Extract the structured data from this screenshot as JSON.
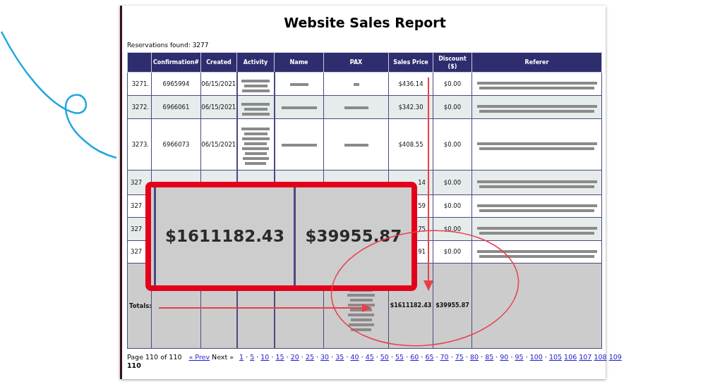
{
  "title": "Website Sales Report",
  "reservations_found": "Reservations found: 3277",
  "columns": [
    "",
    "Confirmation#",
    "Created",
    "Activity",
    "Name",
    "PAX",
    "Sales Price",
    "Discount ($)",
    "Referer"
  ],
  "rows": [
    {
      "number": "3271.",
      "confirmation": "6965994",
      "created": "06/15/2021",
      "sales_price": "$436.14",
      "discount": "$0.00",
      "partly_hidden": false
    },
    {
      "number": "3272.",
      "confirmation": "6966061",
      "created": "06/15/2021",
      "sales_price": "$342.30",
      "discount": "$0.00",
      "partly_hidden": false
    },
    {
      "number": "3273.",
      "confirmation": "6966073",
      "created": "06/15/2021",
      "sales_price": "$408.55",
      "discount": "$0.00",
      "partly_hidden": false
    },
    {
      "number": "327",
      "sales_price": "14",
      "discount": "$0.00",
      "partly_hidden": true
    },
    {
      "number": "327",
      "sales_price": "59",
      "discount": "$0.00",
      "partly_hidden": true
    },
    {
      "number": "327",
      "sales_price": "75",
      "discount": "$0.00",
      "partly_hidden": true
    },
    {
      "number": "327",
      "sales_price": "91",
      "discount": "$0.00",
      "partly_hidden": true
    }
  ],
  "totals": {
    "label": "Totals:",
    "sales_price": "$1611182.43",
    "discount": "$39955.87"
  },
  "callout": {
    "sales_total": "$1611182.43",
    "discount_total": "$39955.87"
  },
  "pagination": {
    "summary": "Page 110 of 110",
    "prev": "« Prev",
    "next": "Next »",
    "pages": [
      {
        "label": "1",
        "selected": false,
        "dot": true
      },
      {
        "label": "5",
        "selected": false,
        "dot": true
      },
      {
        "label": "10",
        "selected": false,
        "dot": true
      },
      {
        "label": "15",
        "selected": false,
        "dot": true
      },
      {
        "label": "20",
        "selected": false,
        "dot": true
      },
      {
        "label": "25",
        "selected": false,
        "dot": true
      },
      {
        "label": "30",
        "selected": false,
        "dot": true
      },
      {
        "label": "35",
        "selected": false,
        "dot": true
      },
      {
        "label": "40",
        "selected": false,
        "dot": true
      },
      {
        "label": "45",
        "selected": false,
        "dot": true
      },
      {
        "label": "50",
        "selected": false,
        "dot": true
      },
      {
        "label": "55",
        "selected": false,
        "dot": true
      },
      {
        "label": "60",
        "selected": false,
        "dot": true
      },
      {
        "label": "65",
        "selected": false,
        "dot": true
      },
      {
        "label": "70",
        "selected": false,
        "dot": true
      },
      {
        "label": "75",
        "selected": false,
        "dot": true
      },
      {
        "label": "80",
        "selected": false,
        "dot": true
      },
      {
        "label": "85",
        "selected": false,
        "dot": true
      },
      {
        "label": "90",
        "selected": false,
        "dot": true
      },
      {
        "label": "95",
        "selected": false,
        "dot": true
      },
      {
        "label": "100",
        "selected": false,
        "dot": true
      },
      {
        "label": "105",
        "selected": false,
        "dot": false
      },
      {
        "label": "106",
        "selected": false,
        "dot": false
      },
      {
        "label": "107",
        "selected": false,
        "dot": false
      },
      {
        "label": "108",
        "selected": false,
        "dot": false
      },
      {
        "label": "109",
        "selected": false,
        "dot": false
      },
      {
        "label": "110",
        "selected": true,
        "dot": false
      }
    ],
    "separator": "·"
  }
}
